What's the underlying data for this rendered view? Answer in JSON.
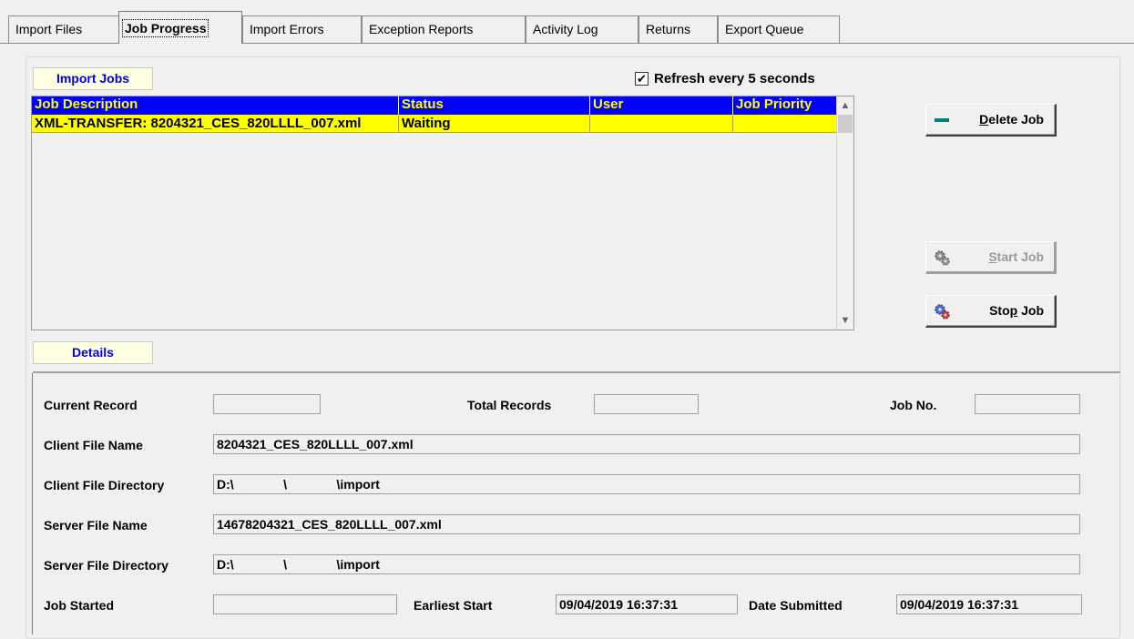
{
  "tabs": [
    {
      "label": "Import Files"
    },
    {
      "label": "Job Progress"
    },
    {
      "label": "Import Errors"
    },
    {
      "label": "Exception Reports"
    },
    {
      "label": "Activity Log"
    },
    {
      "label": "Returns"
    },
    {
      "label": "Export Queue"
    }
  ],
  "import_jobs": {
    "section_label": "Import Jobs",
    "refresh_label": "Refresh every 5 seconds",
    "refresh_checked": true,
    "columns": [
      "Job Description",
      "Status",
      "User",
      "Job Priority"
    ],
    "rows": [
      {
        "description": "XML-TRANSFER: 8204321_CES_820LLLL_007.xml",
        "status": "Waiting",
        "user": "",
        "priority": ""
      }
    ]
  },
  "buttons": {
    "delete_pre": "",
    "delete_u": "D",
    "delete_post": "elete Job",
    "start_pre": "",
    "start_u": "S",
    "start_post": "tart Job",
    "stop_pre": "Sto",
    "stop_u": "p",
    "stop_post": " Job"
  },
  "details": {
    "section_label": "Details",
    "current_record_label": "Current Record",
    "current_record": "",
    "total_records_label": "Total Records",
    "total_records": "",
    "job_no_label": "Job No.",
    "job_no": "",
    "client_file_name_label": "Client File Name",
    "client_file_name": "8204321_CES_820LLLL_007.xml",
    "client_file_directory_label": "Client File Directory",
    "client_file_directory": "D:\\              \\              \\import",
    "server_file_name_label": "Server File Name",
    "server_file_name": "14678204321_CES_820LLLL_007.xml",
    "server_file_directory_label": "Server File Directory",
    "server_file_directory": "D:\\              \\              \\import",
    "job_started_label": "Job Started",
    "job_started": "",
    "earliest_start_label": "Earliest Start",
    "earliest_start": "09/04/2019 16:37:31",
    "date_submitted_label": "Date Submitted",
    "date_submitted": "09/04/2019 16:37:31"
  },
  "colors": {
    "header_bg": "#0000ff",
    "header_text": "#ffff00",
    "row_highlight": "#ffff00",
    "section_label_text": "#0000ee"
  }
}
